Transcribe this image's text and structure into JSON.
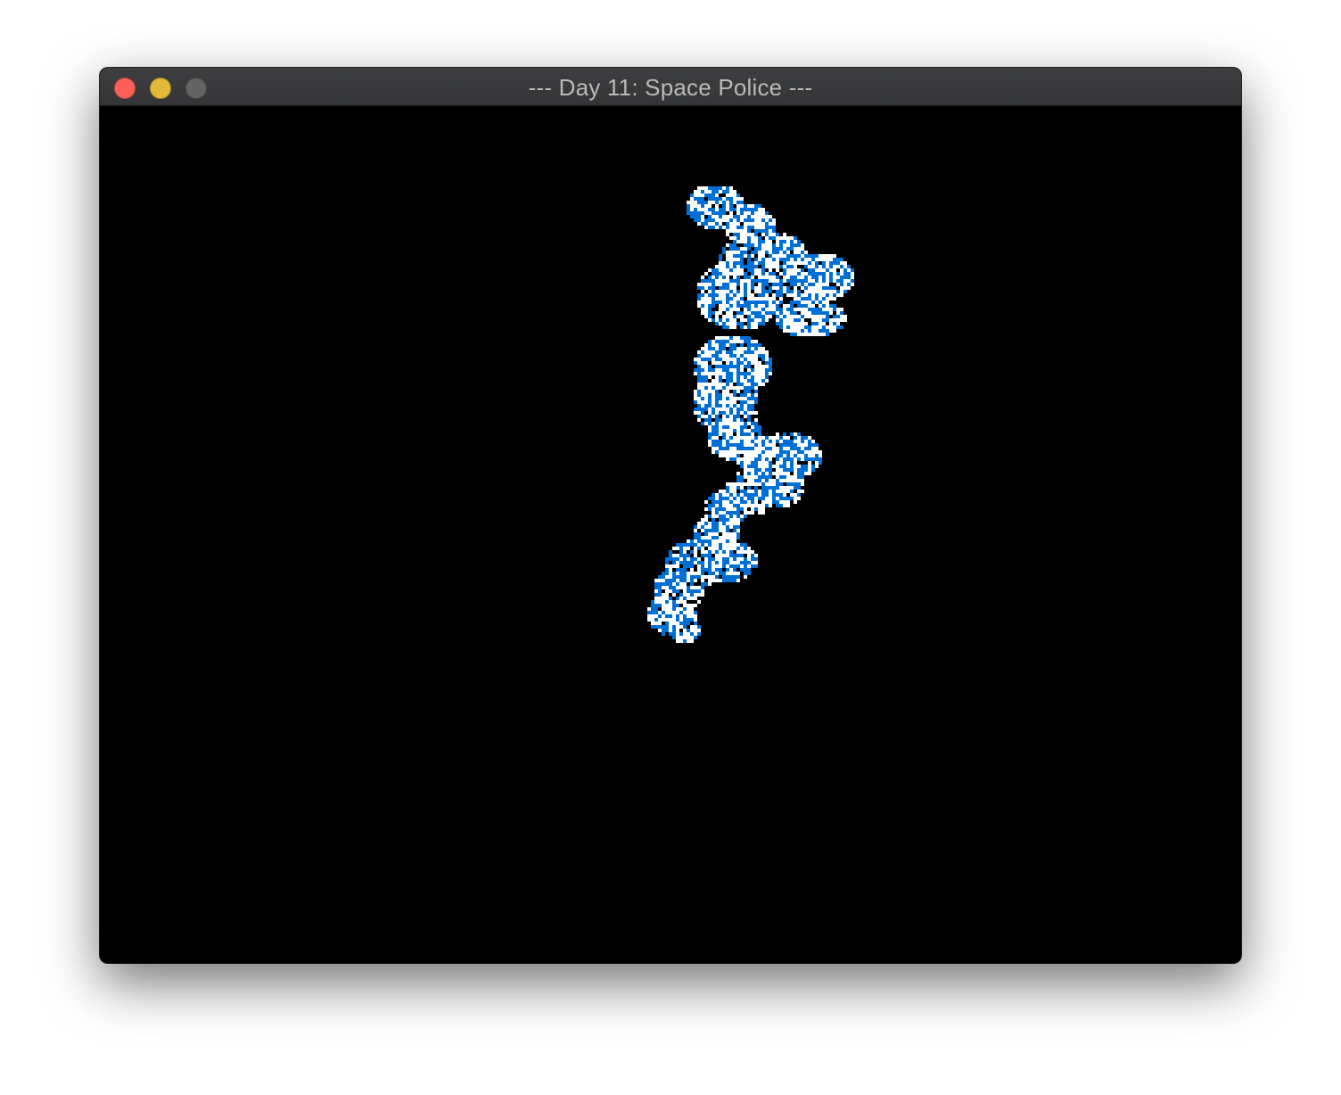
{
  "window": {
    "title": "--- Day 11: Space Police ---",
    "controls": {
      "close_color": "#fe5f57",
      "minimize_color": "#e3b93a",
      "zoom_color": "#636363"
    }
  },
  "canvas": {
    "background_color": "#000000",
    "white_panel_color": "#ffffff",
    "painted_color": "#0070d6"
  }
}
